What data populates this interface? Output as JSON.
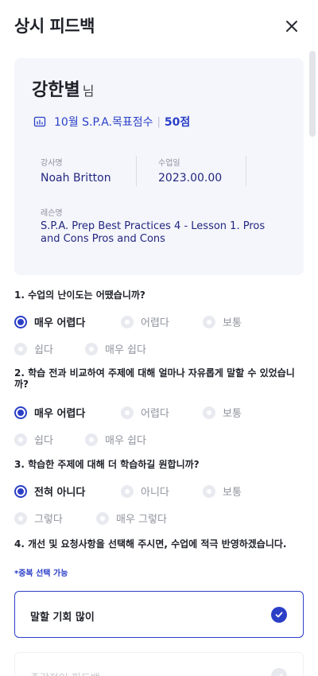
{
  "header": {
    "title": "상시 피드백",
    "close_icon": "close-icon"
  },
  "profile": {
    "name": "강한별",
    "honorific": "님",
    "goal_icon": "chart-icon",
    "goal_text": "10월 S.P.A.목표점수",
    "goal_score": "50점",
    "teacher_label": "강사명",
    "teacher_value": "Noah Britton",
    "date_label": "수업일",
    "date_value": "2023.00.00",
    "lesson_label": "레슨명",
    "lesson_value": "S.P.A. Prep Best Practices 4 - Lesson 1. Pros and Cons Pros and Cons"
  },
  "questions": [
    {
      "text": "1. 수업의 난이도는 어땠습니까?",
      "options": [
        "매우 어렵다",
        "어렵다",
        "보통",
        "쉽다",
        "매우 쉽다"
      ],
      "selected": "매우 어렵다"
    },
    {
      "text": "2. 학습 전과 비교하여 주제에 대해 얼마나 자유롭게 말할 수 있었습니까?",
      "options": [
        "매우 어렵다",
        "어렵다",
        "보통",
        "쉽다",
        "매우 쉽다"
      ],
      "selected": "매우 어렵다"
    },
    {
      "text": "3. 학습한 주제에 대해 더 학습하길 원합니까?",
      "options": [
        "전혀 아니다",
        "아니다",
        "보통",
        "그렇다",
        "매우 그렇다"
      ],
      "selected": "전혀 아니다"
    },
    {
      "text": "4. 개선 및 요청사항을 선택해 주시면, 수업에 적극 반영하겠습니다.",
      "note": "*중복 선택 가능",
      "choices": [
        {
          "label": "말할 기회 많이",
          "checked": true
        },
        {
          "label": "즉각적인 피드백",
          "checked": false
        }
      ]
    }
  ],
  "colors": {
    "accent": "#2b3fc7",
    "navy_text": "#232680",
    "card_bg": "#f4f6fb"
  }
}
